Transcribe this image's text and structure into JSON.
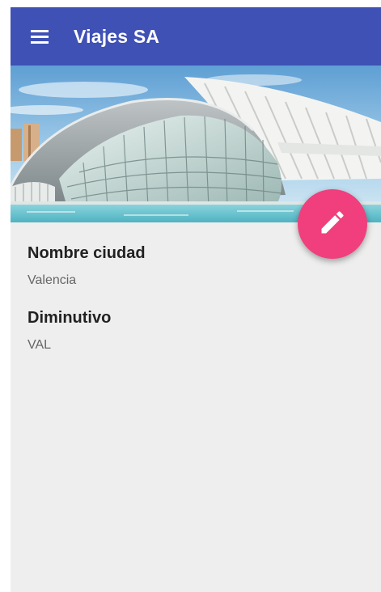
{
  "appbar": {
    "title": "Viajes SA",
    "menu_icon": "menu-icon",
    "color": "#3f51b5"
  },
  "hero": {
    "image": "city-of-arts-and-sciences-photo"
  },
  "fab": {
    "icon": "pencil-icon",
    "color": "#f03f7c"
  },
  "fields": [
    {
      "label": "Nombre ciudad",
      "value": "Valencia"
    },
    {
      "label": "Diminutivo",
      "value": "VAL"
    }
  ]
}
